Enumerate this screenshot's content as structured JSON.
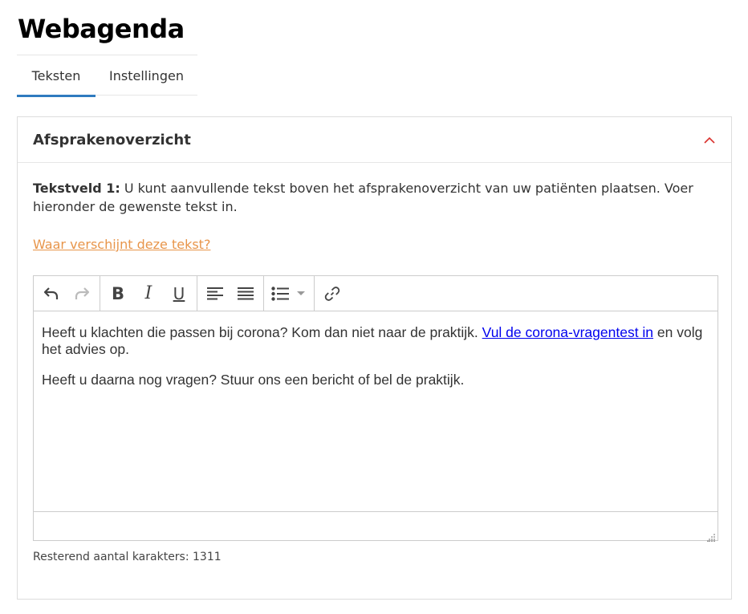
{
  "page": {
    "title": "Webagenda"
  },
  "tabs": [
    {
      "label": "Teksten",
      "active": true
    },
    {
      "label": "Instellingen",
      "active": false
    }
  ],
  "panel": {
    "title": "Afsprakenoverzicht",
    "description_label": "Tekstveld 1:",
    "description_text": " U kunt aanvullende tekst boven het afsprakenoverzicht van uw patiënten plaatsen. Voer hieronder de gewenste tekst in.",
    "help_link": "Waar verschijnt deze tekst?",
    "chevron_color": "#d9302c"
  },
  "editor": {
    "toolbar": {
      "undo_icon": "undo-icon",
      "redo_icon": "redo-icon",
      "bold_label": "B",
      "italic_label": "I",
      "underline_label": "U",
      "align_left_icon": "align-left-icon",
      "align_justify_icon": "align-justify-icon",
      "bullet_list_icon": "bullet-list-icon",
      "link_icon": "link-icon"
    },
    "paragraph1_text": "Heeft u klachten die passen bij corona? Kom dan niet naar de praktijk. ",
    "paragraph1_link": "Vul de corona-vragentest in",
    "paragraph1_tail": " en volg het advies op.",
    "paragraph2_text": "Heeft u daarna nog vragen? Stuur ons een bericht of bel de praktijk."
  },
  "char_count": "Resterend aantal karakters: 1311",
  "colors": {
    "tab_active": "#2f7bbf",
    "help_link": "#e8954a",
    "editor_link": "#0000ee"
  }
}
